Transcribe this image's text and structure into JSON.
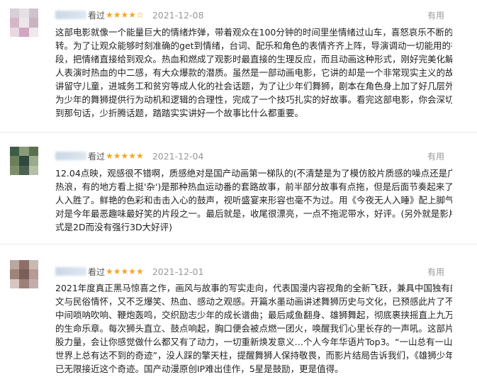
{
  "reviews": [
    {
      "watched": "看过",
      "stars": "★★★★☆",
      "date": "2021-12-08",
      "useful": "有用",
      "lines": [
        "这部电影就像一个能量巨大的情绪炸弹，带着观众在100分钟的时间里坐情绪过山车，喜怒哀乐不断的翻",
        "转。为了让观众能够时刻准确的get到情绪，台词、配乐和角色的表情齐齐上阵，导演调动一切能用的视听手",
        "段，把情绪直接给到观众。热血和燃成了观影时最直接的生理反应，而且动画这种形式，刚好完美化解了真",
        "人表演时热血的中二感，有大众爆款的潜质。虽然是一部动画电影，它讲的却是一个非常现实主义的故事，",
        "讲留守儿童，进城务工和贫穷等成人化的社会话题，为了让少年们舞狮，剧本在角色身上加了好几层外力，",
        "为少年的舞狮提供行为动机和逻辑的合理性，完成了一个技巧扎实的好故事。看完这部电影，你会深切体会",
        "到那句话，少折腾话题，踏踏实实讲好一个故事比什么都重要。"
      ]
    },
    {
      "watched": "看过",
      "stars": "★★★★★",
      "date": "2021-12-04",
      "useful": "有用",
      "lines": [
        "12.04点映，观感很不错啊，质感绝对是国产动画第一梯队的(不清楚是为了模仿胶片质感的噪点还是广东的",
        "热浪，有的地方看上挺'杂')是那种热血运动番的套路故事，前半部分故事有点拖，但是后面节奏起来了就引",
        "人入胜了。鲜艳的色彩和击击入心的鼓声，视听盛宴来形容也毫不为过。用《今夜无人入睡》配上脚气，绝",
        "对是今年最恶趣味最好笑的片段之一。最后就是，收尾很漂亮，一点不拖泥带水，好评。(另外就是影片格",
        "式是2D而没有强行3D大好评)"
      ]
    },
    {
      "watched": "看过",
      "stars": "★★★★★",
      "date": "2021-12-01",
      "useful": "有用",
      "lines": [
        "2021年度真正黑马惊喜之作，画风与故事的写实走向，代表国漫内容视角的全新飞跃，兼具中国独有的人",
        "文与民俗情怀，又不乏爆笑、热血、感动之观感。开篇水墨动画讲述舞狮历史与文化，已预感此片了不得；",
        "中间唢呐吹响、鞭炮轰鸣，交织励志少年的成长谱曲；最后咸鱼翻身、雄狮舞起，彻底裹挟摇直上九万里",
        "的生命乐章。每次狮头直立、鼓点响起，胸口便会被点燃一团火，唤醒我们心里长存的一声吼。这部片有一",
        "股力量，会让你感觉做什么都又有了动力，一切重新焕发意义…个人今年华语片Top3。“一山总有一山高，",
        "世界上总有达不到的奇迹”，没人踩的擎天柱，提醒舞狮人保持敬畏，而影片结局告诉我们，《雄狮少年》",
        "已无限接近这个奇迹。国产动漫原创IP难出佳作，5星是鼓励，更是值得。"
      ]
    }
  ]
}
